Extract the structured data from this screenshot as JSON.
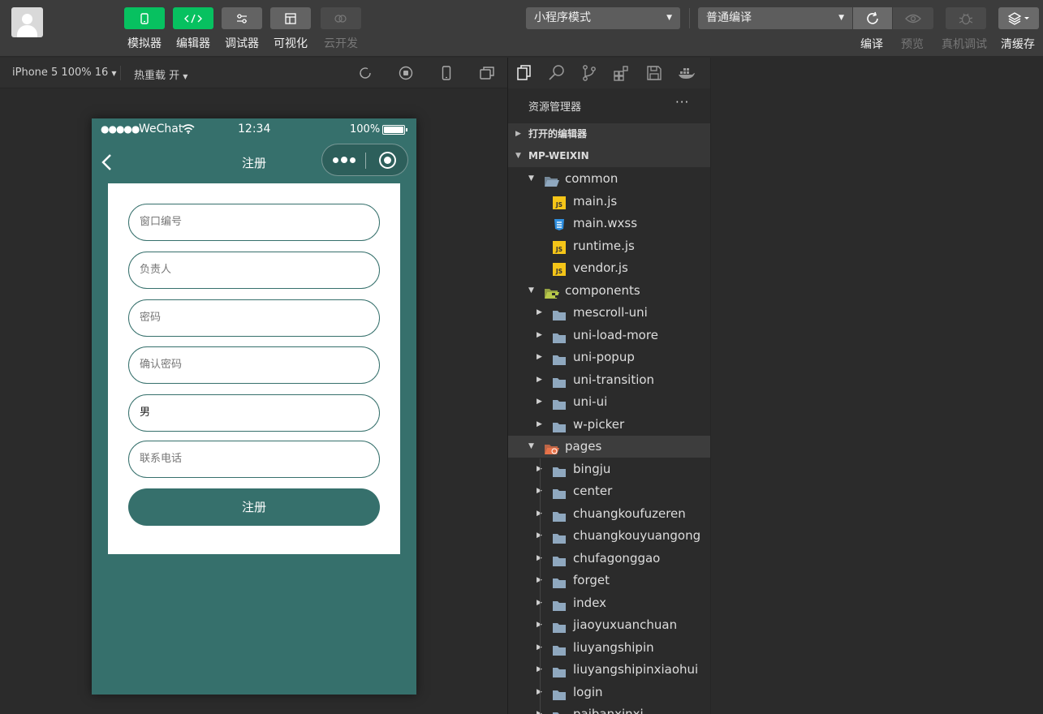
{
  "toolbar": {
    "tools": [
      {
        "label": "模拟器",
        "icon": "phone-icon",
        "style": "green"
      },
      {
        "label": "编辑器",
        "icon": "code-icon",
        "style": "green"
      },
      {
        "label": "调试器",
        "icon": "debug-sliders-icon",
        "style": "gray"
      },
      {
        "label": "可视化",
        "icon": "layout-icon",
        "style": "gray"
      },
      {
        "label": "云开发",
        "icon": "cloud-icon",
        "style": "disabled"
      }
    ],
    "mode_select": "小程序模式",
    "compile_select": "普通编译",
    "actions": [
      {
        "label": "编译",
        "icon": "refresh-icon",
        "disabled": false
      },
      {
        "label": "预览",
        "icon": "eye-icon",
        "disabled": true
      },
      {
        "label": "真机调试",
        "icon": "bug-icon",
        "disabled": true
      },
      {
        "label": "清缓存",
        "icon": "layers-icon",
        "disabled": false
      }
    ]
  },
  "simbar": {
    "device": "iPhone 5 100% 16",
    "hot_reload": "热重载 开"
  },
  "phone": {
    "status": {
      "carrier": "WeChat",
      "time": "12:34",
      "battery": "100%"
    },
    "nav_title": "注册",
    "fields": [
      {
        "placeholder": "窗口编号",
        "value": ""
      },
      {
        "placeholder": "负责人",
        "value": ""
      },
      {
        "placeholder": "密码",
        "value": ""
      },
      {
        "placeholder": "确认密码",
        "value": ""
      },
      {
        "placeholder": "",
        "value": "男"
      },
      {
        "placeholder": "联系电话",
        "value": ""
      }
    ],
    "submit_label": "注册"
  },
  "explorer": {
    "title": "资源管理器",
    "more": "···",
    "open_editors": "打开的编辑器",
    "project": "MP-WEIXIN",
    "common": {
      "name": "common",
      "files": [
        {
          "name": "main.js",
          "type": "js"
        },
        {
          "name": "main.wxss",
          "type": "css"
        },
        {
          "name": "runtime.js",
          "type": "js"
        },
        {
          "name": "vendor.js",
          "type": "js"
        }
      ]
    },
    "components": {
      "name": "components",
      "folders": [
        "mescroll-uni",
        "uni-load-more",
        "uni-popup",
        "uni-transition",
        "uni-ui",
        "w-picker"
      ]
    },
    "pages": {
      "name": "pages",
      "folders": [
        "bingju",
        "center",
        "chuangkoufuzeren",
        "chuangkouyuangong",
        "chufagonggao",
        "forget",
        "index",
        "jiaoyuxuanchuan",
        "liuyangshipin",
        "liuyangshipinxiaohui",
        "login",
        "paibanxinxi"
      ]
    }
  },
  "colors": {
    "accent_green": "#07c160",
    "phone_theme": "#36706c",
    "js_badge": "#f5c518",
    "css_badge": "#2f8fe0"
  }
}
